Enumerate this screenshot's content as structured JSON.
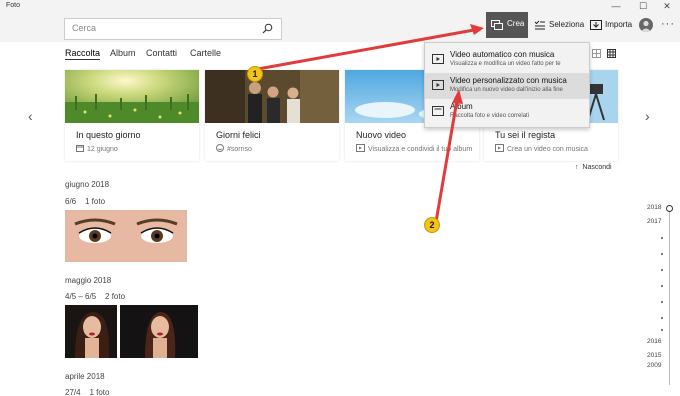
{
  "app": {
    "title": "Foto"
  },
  "window_controls": {
    "minimize": "—",
    "maximize": "☐",
    "close": "✕"
  },
  "search": {
    "placeholder": "Cerca"
  },
  "toolbar": {
    "crea_label": "Crea",
    "seleziona_label": "Seleziona",
    "importa_label": "Importa",
    "more_label": "···"
  },
  "tabs": [
    "Raccolta",
    "Album",
    "Contatti",
    "Cartelle"
  ],
  "cards": [
    {
      "title": "In questo giorno",
      "subtitle": "12 giugno",
      "icon": "calendar-icon"
    },
    {
      "title": "Giorni felici",
      "subtitle": "#sorriso",
      "icon": "smile-icon"
    },
    {
      "title": "Nuovo video",
      "subtitle": "Visualizza e condividi il tuo album",
      "icon": "video-icon"
    },
    {
      "title": "Tu sei il regista",
      "subtitle": "Crea un video con musica",
      "icon": "video-icon"
    }
  ],
  "hide_label": "Nascondi",
  "sections": [
    {
      "title": "giugno 2018",
      "sub": "6/6    1 foto"
    },
    {
      "title": "maggio 2018",
      "sub": "4/5 – 6/5    2 foto"
    },
    {
      "title": "aprile 2018",
      "sub": "27/4    1 foto"
    }
  ],
  "menu": [
    {
      "title": "Video automatico con musica",
      "subtitle": "Visualizza e modifica un video fatto per te"
    },
    {
      "title": "Video personalizzato con musica",
      "subtitle": "Modifica un nuovo video dall'inizio alla fine"
    },
    {
      "title": "Album",
      "subtitle": "Raccolta foto e video correlati"
    }
  ],
  "timeline": [
    "2018",
    "2017",
    "2016",
    "2015",
    "2009"
  ],
  "badges": [
    "1",
    "2"
  ],
  "colors": {
    "arrow": "#e23b3b",
    "crea_bg": "#555555",
    "badge": "#f2c418"
  }
}
